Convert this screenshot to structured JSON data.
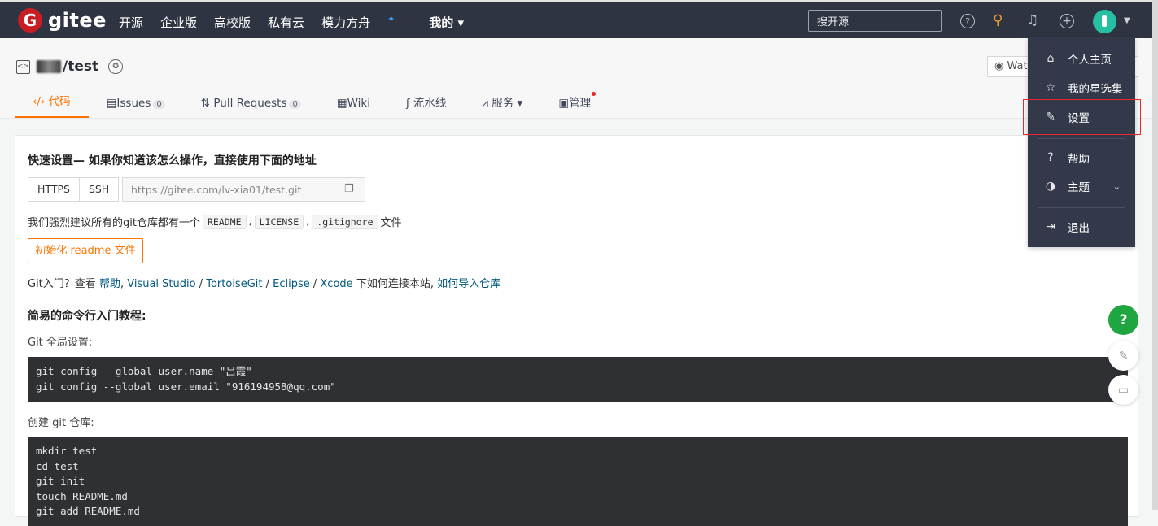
{
  "brand": {
    "logo_letter": "G",
    "name": "gitee",
    "color": "#c71d23"
  },
  "topnav": {
    "items": [
      "开源",
      "企业版",
      "高校版",
      "私有云",
      "模力方舟",
      "我的 ▾"
    ],
    "sparkle": "✦",
    "search_placeholder": "搜开源"
  },
  "repo": {
    "name": "/test",
    "watch_label": "Watc"
  },
  "tabs": [
    {
      "icon": "‹/›",
      "label": "代码"
    },
    {
      "icon": "▤",
      "label": "Issues",
      "count": "0"
    },
    {
      "icon": "⇅",
      "label": "Pull Requests",
      "count": "0"
    },
    {
      "icon": "▦",
      "label": "Wiki"
    },
    {
      "icon": "ʃ",
      "label": "流水线"
    },
    {
      "icon": "⩘",
      "label": "服务 ▾"
    },
    {
      "icon": "▣",
      "label": "管理"
    }
  ],
  "quick_setup": {
    "title": "快速设置— 如果你知道该怎么操作，直接使用下面的地址",
    "https_label": "HTTPS",
    "ssh_label": "SSH",
    "url": "https://gitee.com/lv-xia01/test.git",
    "recommend_prefix": "我们强烈建议所有的git仓库都有一个",
    "files": [
      "README",
      "LICENSE",
      ".gitignore"
    ],
    "recommend_suffix": "文件",
    "sep": ",",
    "init_button": "初始化 readme 文件",
    "intro_prefix": "Git入门？查看",
    "intro_links": [
      "帮助",
      "Visual Studio",
      "TortoiseGit",
      "Eclipse",
      "Xcode"
    ],
    "intro_mid": "下如何连接本站,",
    "intro_import": "如何导入仓库"
  },
  "tutorial": {
    "title": "简易的命令行入门教程:",
    "global_label": "Git 全局设置:",
    "global_code": "git config --global user.name \"吕霞\"\ngit config --global user.email \"916194958@qq.com\"",
    "create_label": "创建 git 仓库:",
    "create_code": "mkdir test\ncd test\ngit init\ntouch README.md\ngit add README.md"
  },
  "user_menu": {
    "items": [
      {
        "icon": "⌂",
        "label": "个人主页"
      },
      {
        "icon": "☆",
        "label": "我的星选集"
      },
      {
        "icon": "✎",
        "label": "设置"
      },
      {
        "icon": "?",
        "label": "帮助"
      },
      {
        "icon": "◑",
        "label": "主题"
      },
      {
        "icon": "⇥",
        "label": "退出"
      }
    ],
    "chevron": "⌄"
  },
  "floating": {
    "help": "?",
    "edit": "✎",
    "chat": "▭"
  },
  "colors": {
    "accent": "#fe7300",
    "topbar": "#2f3443",
    "highlight": "#e62828",
    "help_green": "#20a640"
  }
}
